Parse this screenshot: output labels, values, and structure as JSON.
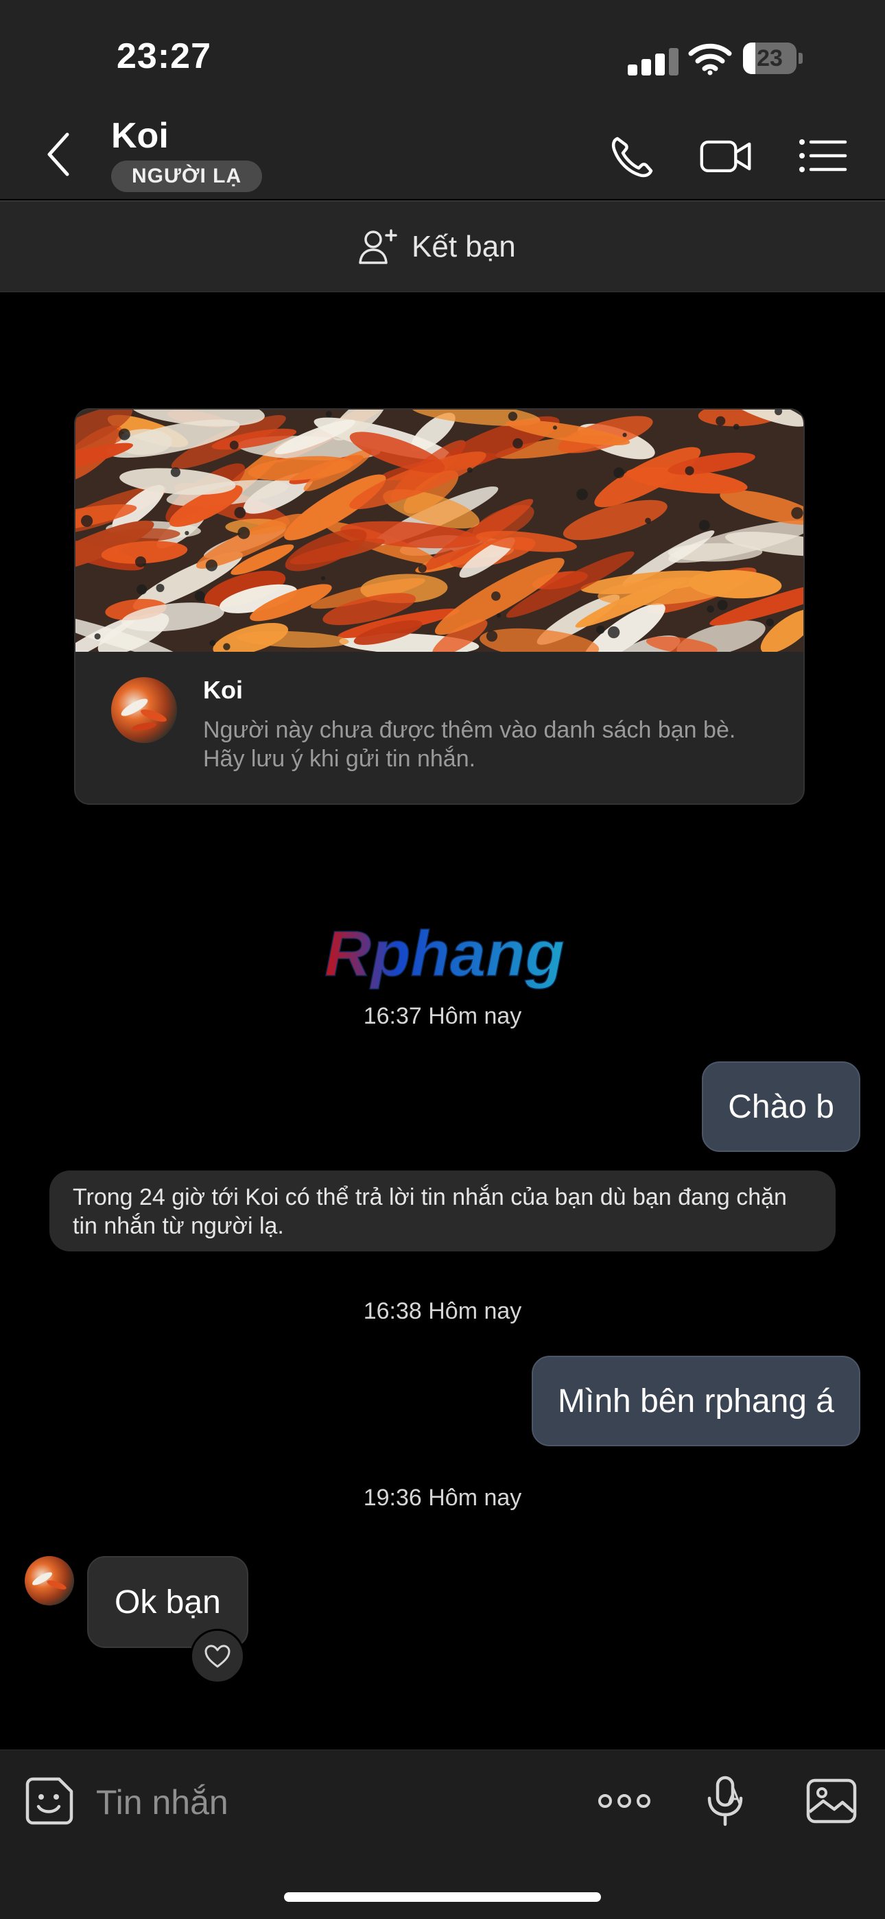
{
  "status_bar": {
    "time": "23:27",
    "battery": "23",
    "battery_level": 0.23
  },
  "header": {
    "title": "Koi",
    "badge": "NGƯỜI LẠ"
  },
  "friend_bar": {
    "label": "Kết bạn"
  },
  "profile_card": {
    "name": "Koi",
    "description": "Người này chưa được thêm vào danh sách bạn bè. Hãy lưu ý khi gửi tin nhắn."
  },
  "watermark": "Rphang",
  "messages": {
    "ts1": "16:37 Hôm nay",
    "out1": "Chào b",
    "system_note": "Trong 24 giờ tới Koi có thể trả lời tin nhắn của bạn dù bạn đang chặn tin nhắn từ người lạ.",
    "ts2": "16:38 Hôm nay",
    "out2": "Mình bên rphang á",
    "ts3": "19:36 Hôm nay",
    "in1": "Ok bạn"
  },
  "composer": {
    "placeholder": "Tin nhắn"
  },
  "icons": {
    "back": "chevron-left-icon",
    "call": "phone-icon",
    "video": "video-camera-icon",
    "menu": "list-menu-icon",
    "add_friend": "add-user-icon",
    "emoji": "sticker-smile-icon",
    "more": "more-dots-icon",
    "voice": "microphone-icon",
    "image": "image-icon",
    "reaction": "heart-icon"
  },
  "colors": {
    "header_bg": "#232323",
    "outgoing_bubble": "#3a4453",
    "incoming_bubble": "#2c2c2c",
    "page_bg": "#000000"
  }
}
